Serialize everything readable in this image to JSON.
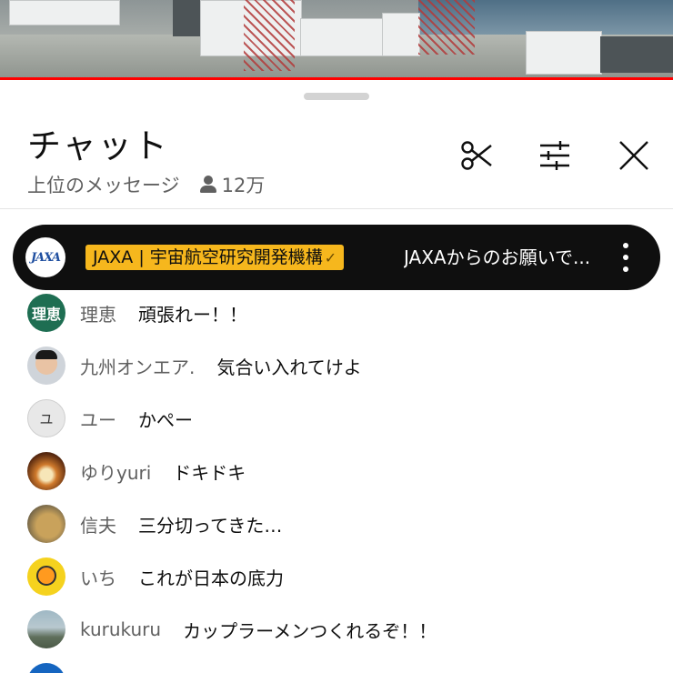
{
  "video": {
    "progress_color": "#ff0000"
  },
  "chat_panel": {
    "title": "チャット",
    "mode_label": "上位のメッセージ",
    "viewer_count": "12万",
    "tools": [
      "scissors-icon",
      "tune-icon",
      "close-icon"
    ]
  },
  "pinned": {
    "avatar_text": "JAXA",
    "author": "JAXA | 宇宙航空研究開発機構",
    "verified_mark": "✓",
    "message": "JAXAからのお願いで...",
    "badge_color": "#f6b71d"
  },
  "messages": [
    {
      "avatar_text": "理恵",
      "author": "理恵",
      "text": "頑張れー！！"
    },
    {
      "avatar_text": "",
      "author": "九州オンエア.",
      "text": "気合い入れてけよ"
    },
    {
      "avatar_text": "ユ",
      "author": "ユー",
      "text": "かぺー"
    },
    {
      "avatar_text": "",
      "author": "ゆりyuri",
      "text": "ドキドキ"
    },
    {
      "avatar_text": "",
      "author": "信夫",
      "text": "三分切ってきた…"
    },
    {
      "avatar_text": "",
      "author": "いち",
      "text": "これが日本の底力"
    },
    {
      "avatar_text": "",
      "author": "kurukuru",
      "text": "カップラーメンつくれるぞ！！"
    }
  ]
}
